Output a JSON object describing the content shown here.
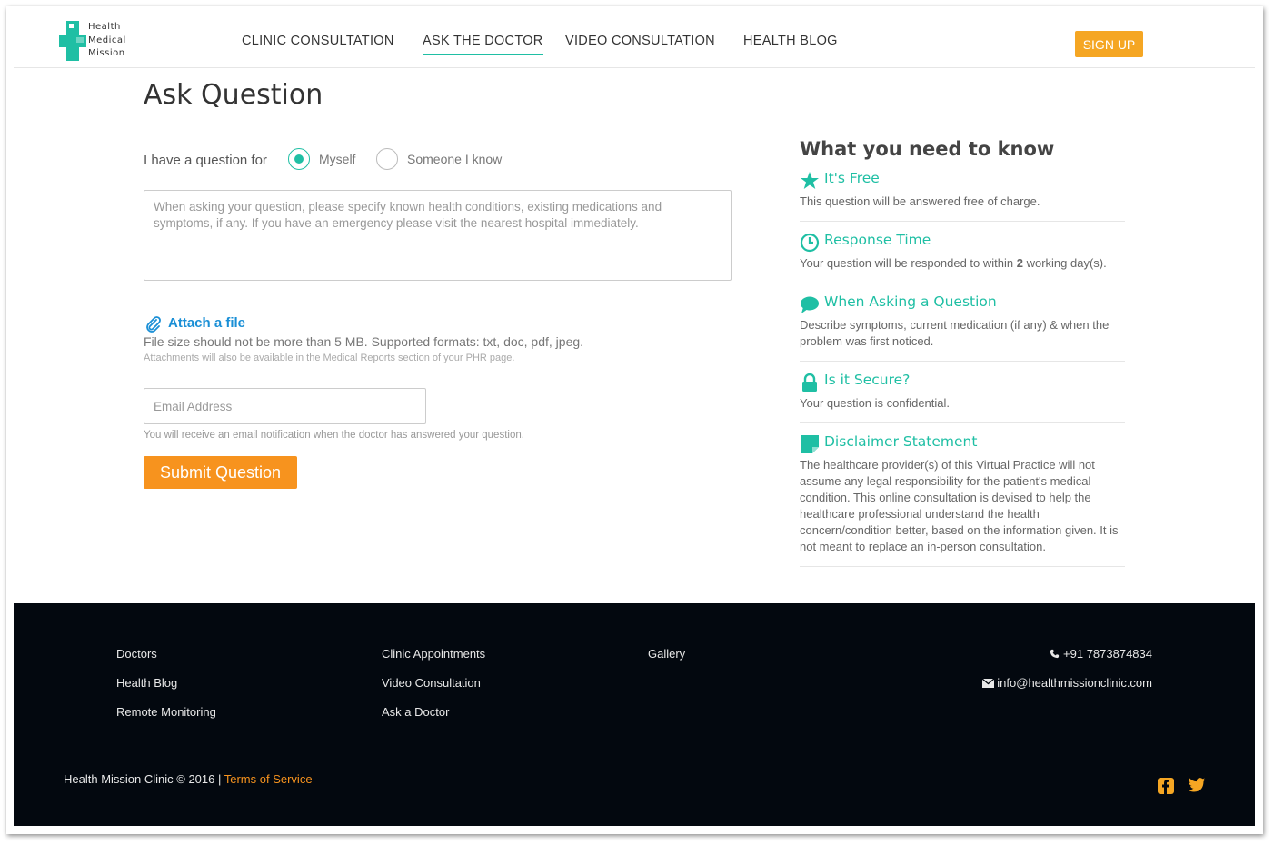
{
  "brand": {
    "logo_lines": [
      "Health",
      "Medical",
      "Mission"
    ]
  },
  "nav": {
    "items": [
      {
        "label": "CLINIC CONSULTATION"
      },
      {
        "label": "ASK THE DOCTOR",
        "active": true
      },
      {
        "label": "VIDEO CONSULTATION"
      },
      {
        "label": "HEALTH BLOG"
      }
    ],
    "signup_label": "SIGN UP"
  },
  "form": {
    "title": "Ask Question",
    "question_for_label": "I have a question for",
    "options": [
      {
        "label": "Myself",
        "selected": true
      },
      {
        "label": "Someone I know",
        "selected": false
      }
    ],
    "question_placeholder": "When asking your question, please specify known health conditions, existing medications and symptoms, if any. If you have an emergency please visit the nearest hospital immediately.",
    "attach_label": "Attach a file",
    "file_size_note": "File size should not be more than 5 MB. Supported formats: txt, doc, pdf, jpeg.",
    "attachments_note": "Attachments will also be available in the Medical Reports section of your PHR page.",
    "email_placeholder": "Email Address",
    "email_note": "You will receive an email notification when the doctor has answered your question.",
    "submit_label": "Submit Question"
  },
  "sidebar": {
    "title": "What you need to know",
    "items": [
      {
        "icon": "star-icon",
        "title": "It's Free",
        "body": "This question will be answered free of charge."
      },
      {
        "icon": "clock-icon",
        "title": "Response Time",
        "body_pre": "Your question will be responded to within ",
        "body_bold": "2",
        "body_post": " working day(s)."
      },
      {
        "icon": "chat-bubble-icon",
        "title": "When Asking a Question",
        "body": "Describe symptoms, current medication (if any) & when the problem was first noticed."
      },
      {
        "icon": "lock-icon",
        "title": "Is it Secure?",
        "body": "Your question is confidential."
      },
      {
        "icon": "note-icon",
        "title": "Disclaimer Statement",
        "body": "The healthcare provider(s) of this Virtual Practice will not assume any legal responsibility for the patient's medical condition. This online consultation is devised to help the healthcare professional understand the health concern/condition better, based on the information given. It is not meant to replace an in-person consultation."
      }
    ]
  },
  "footer": {
    "col1": [
      "Doctors",
      "Health Blog",
      "Remote Monitoring"
    ],
    "col2": [
      "Clinic Appointments",
      "Video Consultation",
      "Ask a Doctor"
    ],
    "col3": [
      "Gallery"
    ],
    "phone": "+91 7873874834",
    "email": "info@healthmissionclinic.com",
    "copyright": "Health Mission Clinic © 2016 | ",
    "terms_label": "Terms of Service",
    "social": [
      "facebook-icon",
      "twitter-icon"
    ]
  },
  "colors": {
    "accent": "#1fbfa4",
    "orange": "#f7931e",
    "signup": "#f5a623",
    "footer_bg": "#03080f",
    "link_blue": "#1a8fd6"
  }
}
